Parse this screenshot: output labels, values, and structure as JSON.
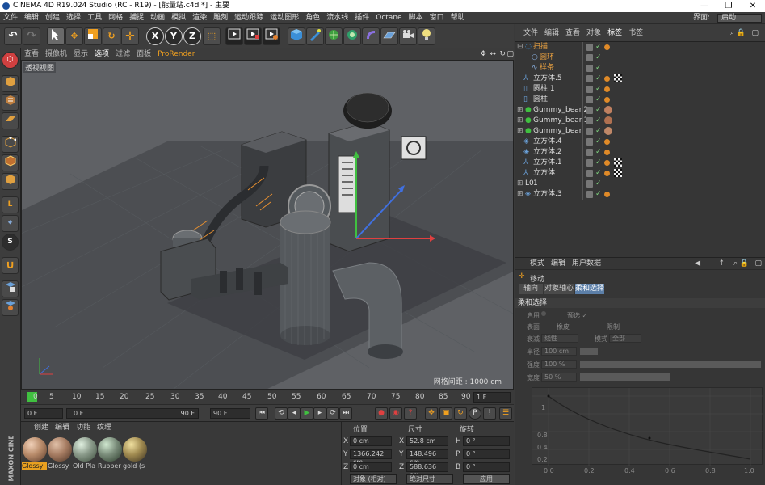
{
  "window": {
    "title": "CINEMA 4D R19.024 Studio (RC - R19) - [能量站.c4d *] - 主要",
    "minimize": "—",
    "maximize": "❐",
    "close": "✕"
  },
  "menu": {
    "items": [
      "文件",
      "编辑",
      "创建",
      "选择",
      "工具",
      "网格",
      "捕捉",
      "动画",
      "模拟",
      "渲染",
      "雕刻",
      "运动跟踪",
      "运动图形",
      "角色",
      "流水线",
      "插件",
      "Octane",
      "脚本",
      "窗口",
      "帮助"
    ],
    "layout_label": "界面:",
    "layout_value": "启动"
  },
  "toolbar": {
    "x_axis": "X",
    "y_axis": "Y",
    "z_axis": "Z"
  },
  "left_toolbar": {
    "snap_label": "S"
  },
  "viewport": {
    "menu": [
      "查看",
      "摄像机",
      "显示",
      "选项",
      "过滤",
      "面板",
      "ProRender"
    ],
    "active_menu": "ProRender",
    "label": "透视视图",
    "grid_info": "网格间距 : 1000 cm"
  },
  "timeline": {
    "ticks": [
      "0",
      "5",
      "10",
      "15",
      "20",
      "25",
      "30",
      "35",
      "40",
      "45",
      "50",
      "55",
      "60",
      "65",
      "70",
      "75",
      "80",
      "85",
      "90"
    ],
    "end_field": "1 F"
  },
  "transport": {
    "start_frame": "0 F",
    "current_frame": "0 F",
    "max_frame": "90 F",
    "end_frame": "90 F",
    "preview_end": "90 F"
  },
  "materials": {
    "tabs": [
      "创建",
      "编辑",
      "功能",
      "纹理"
    ],
    "items": [
      {
        "label": "Glossy",
        "color": "#b88b6a",
        "selected": true
      },
      {
        "label": "Glossy",
        "color": "#a67c62",
        "selected": false
      },
      {
        "label": "Old Pla",
        "color": "#8a9a8a",
        "selected": false
      },
      {
        "label": "Rubber",
        "color": "#7a8c7a",
        "selected": false
      },
      {
        "label": "gold (s",
        "color": "#a08a50",
        "selected": false
      }
    ],
    "brand": "MAXON CINEMA 4D"
  },
  "coords": {
    "headers": [
      "位置",
      "尺寸",
      "旋转"
    ],
    "rows": [
      {
        "axis": "X",
        "pos": "0 cm",
        "size_axis": "X",
        "size": "52.8 cm",
        "rot_axis": "H",
        "rot": "0 °"
      },
      {
        "axis": "Y",
        "pos": "1366.242 cm",
        "size_axis": "Y",
        "size": "148.496 cm",
        "rot_axis": "P",
        "rot": "0 °"
      },
      {
        "axis": "Z",
        "pos": "0 cm",
        "size_axis": "Z",
        "size": "588.636 cm",
        "rot_axis": "B",
        "rot": "0 °"
      }
    ],
    "mode": "对象 (相对)",
    "size_mode": "绝对尺寸",
    "apply": "应用"
  },
  "objects": {
    "menu": [
      "文件",
      "编辑",
      "查看",
      "对象",
      "标签",
      "书签"
    ],
    "rows": [
      {
        "name": "扫描",
        "color": "#e8a040",
        "indent": 0
      },
      {
        "name": "圆环",
        "color": "#e8a040",
        "indent": 1
      },
      {
        "name": "样条",
        "color": "#e8a040",
        "indent": 1
      },
      {
        "name": "立方体.5",
        "color": "#ddd",
        "indent": 0
      },
      {
        "name": "圆柱.1",
        "color": "#ddd",
        "indent": 0
      },
      {
        "name": "圆柱",
        "color": "#ddd",
        "indent": 0
      },
      {
        "name": "Gummy_bear.2",
        "color": "#ddd",
        "indent": 0
      },
      {
        "name": "Gummy_bear.1",
        "color": "#ddd",
        "indent": 0
      },
      {
        "name": "Gummy_bear",
        "color": "#ddd",
        "indent": 0
      },
      {
        "name": "立方体.4",
        "color": "#ddd",
        "indent": 0
      },
      {
        "name": "立方体.2",
        "color": "#ddd",
        "indent": 0
      },
      {
        "name": "立方体.1",
        "color": "#ddd",
        "indent": 0
      },
      {
        "name": "立方体",
        "color": "#ddd",
        "indent": 0
      },
      {
        "name": "1",
        "color": "#ddd",
        "indent": 0
      },
      {
        "name": "立方体.3",
        "color": "#ddd",
        "indent": 0
      }
    ]
  },
  "attributes": {
    "menu": [
      "模式",
      "编辑",
      "用户数据"
    ],
    "title": "移动",
    "tabs": [
      "轴向",
      "对象轴心",
      "柔和选择"
    ],
    "active_tab": "柔和选择",
    "section": "柔和选择",
    "enable": "启用",
    "preview": "预选 ✓",
    "surface": "表面",
    "rubber": "橡皮",
    "limit": "限制",
    "falloff_label": "衰减",
    "falloff_value": "线性",
    "mode_label": "模式",
    "mode_value": "全部",
    "radius_label": "半径",
    "radius_value": "100 cm",
    "strength_label": "强度",
    "strength_value": "100 %",
    "width_label": "宽度",
    "width_value": "50 %",
    "graph_y": [
      "1",
      "0.8",
      "0.4",
      "0.2"
    ],
    "graph_x": [
      "0.0",
      "0.2",
      "0.4",
      "0.6",
      "0.8",
      "1.0"
    ]
  }
}
